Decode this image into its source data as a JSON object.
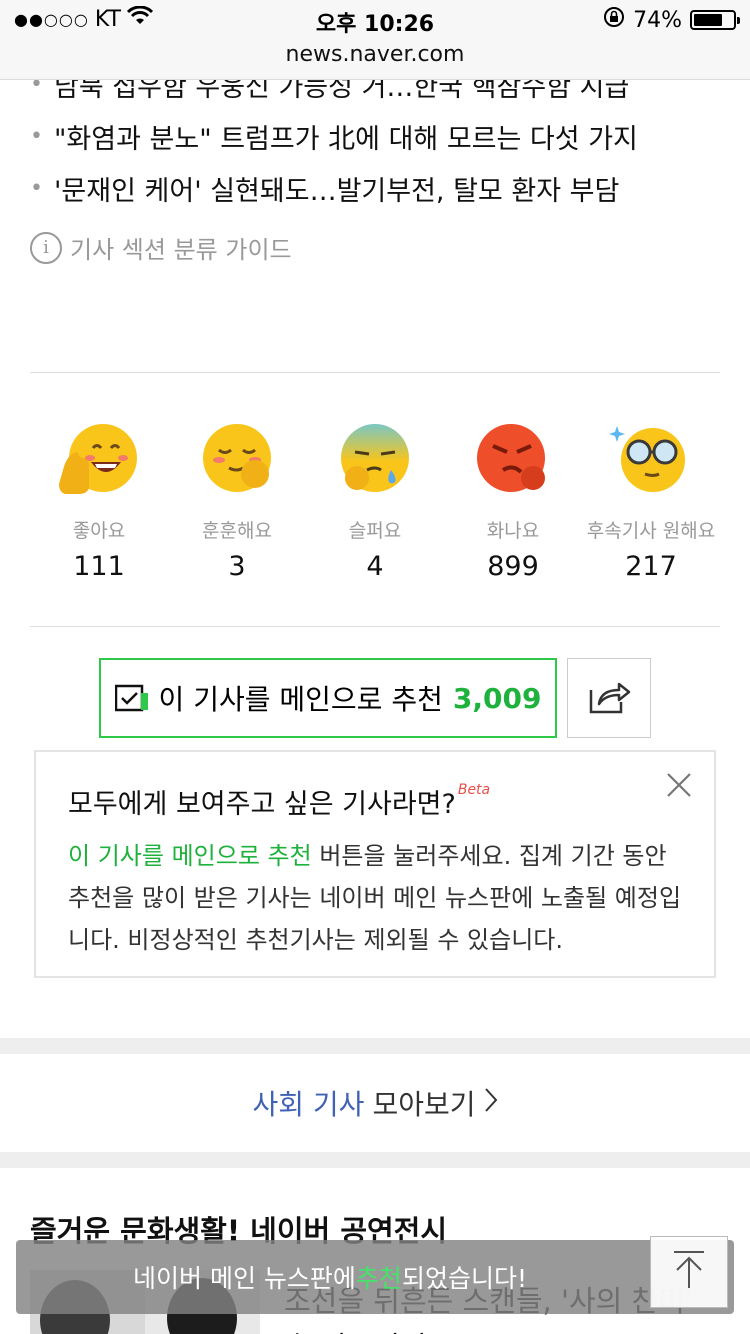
{
  "status_bar": {
    "carrier": "KT",
    "time": "오후 10:26",
    "battery_percent": "74%",
    "battery_level": 0.74,
    "signal_dots": "●●○○○"
  },
  "url": "news.naver.com",
  "headlines": [
    "남북 접우함 우웅신 가능성 거…한국 핵잠수함 시급",
    "\"화염과 분노\" 트럼프가 北에 대해 모르는 다섯 가지",
    "'문재인 케어' 실현돼도…발기부전, 탈모 환자 부담"
  ],
  "guide": {
    "icon": "info-icon",
    "label": "기사 섹션 분류 가이드"
  },
  "reactions": [
    {
      "label": "좋아요",
      "count": "111",
      "icon": "like-emoji-icon"
    },
    {
      "label": "훈훈해요",
      "count": "3",
      "icon": "warm-emoji-icon"
    },
    {
      "label": "슬퍼요",
      "count": "4",
      "icon": "sad-emoji-icon"
    },
    {
      "label": "화나요",
      "count": "899",
      "icon": "angry-emoji-icon"
    },
    {
      "label": "후속기사 원해요",
      "count": "217",
      "icon": "want-more-emoji-icon"
    }
  ],
  "recommend": {
    "label": "이 기사를 메인으로 추천",
    "count": "3,009"
  },
  "info_box": {
    "title": "모두에게 보여주고 싶은 기사라면?",
    "beta": "Beta",
    "highlight": "이 기사를 메인으로 추천",
    "body": " 버튼을 눌러주세요. 집계 기간 동안 추천을 많이 받은 기사는 네이버 메인 뉴스판에 노출될 예정입니다. 비정상적인 추천기사는 제외될 수 있습니다."
  },
  "more_link": {
    "section": "사회 기사",
    "label": "모아보기"
  },
  "promo": {
    "title": "즐거운 문화생활! 네이버 공연전시",
    "snippet": "조선을 뒤흔든 스캔들, '사의 찬미' 속 미스터리"
  },
  "toast": {
    "prefix": "네이버 메인 뉴스판에 ",
    "highlight": "추천",
    "suffix": "되었습니다!"
  },
  "colors": {
    "green": "#1eb13c",
    "section_blue": "#3f62b5"
  }
}
